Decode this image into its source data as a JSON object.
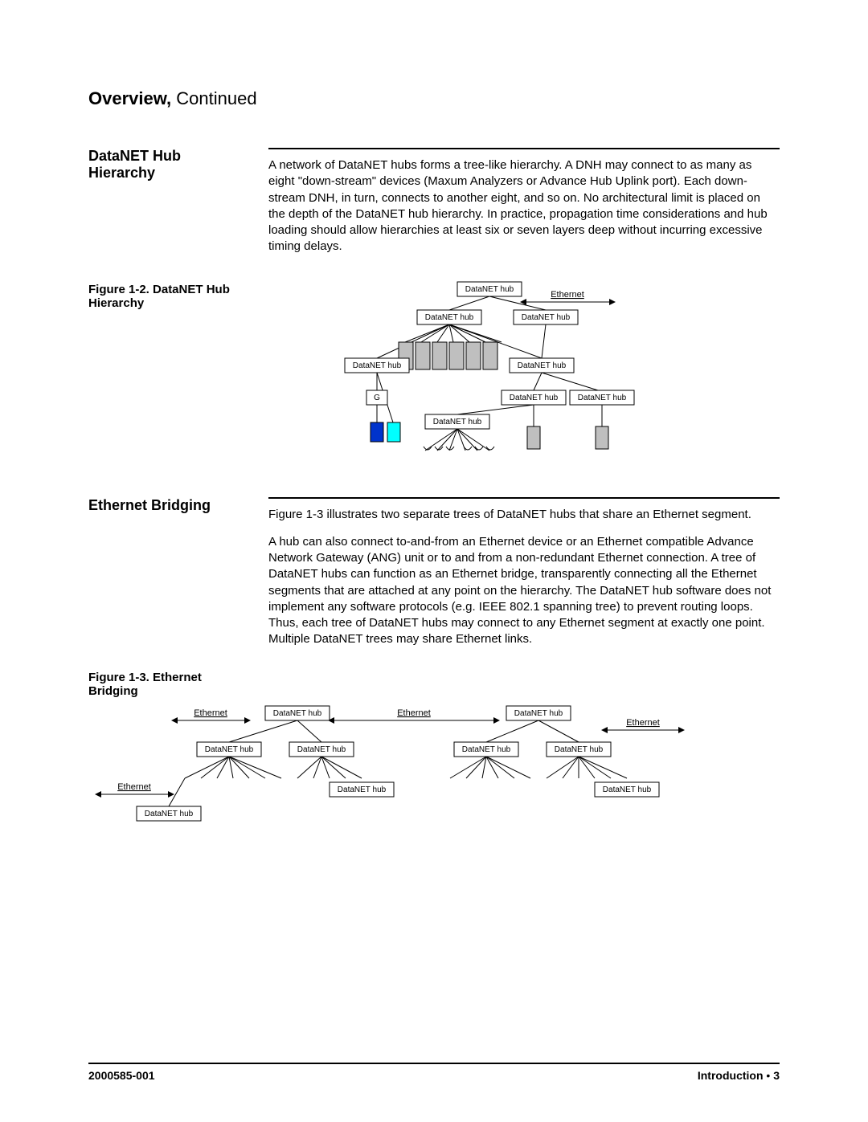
{
  "title": {
    "main": "Overview,",
    "cont": " Continued"
  },
  "section1": {
    "heading": "DataNET Hub Hierarchy",
    "para": "A network of DataNET hubs forms a tree-like hierarchy. A DNH may connect to as many as eight \"down-stream\" devices (Maxum Analyzers or Advance Hub Uplink port). Each down-stream DNH, in turn, connects to another eight, and so on. No architectural limit is placed on the depth of the DataNET hub hierarchy. In practice, propagation time considerations and hub loading should allow hierarchies at least six or seven layers deep without incurring excessive timing delays.",
    "fig_caption": "Figure 1-2. DataNET Hub Hierarchy"
  },
  "labels": {
    "hub": "DataNET hub",
    "ethernet": "Ethernet",
    "g": "G"
  },
  "section2": {
    "heading": "Ethernet Bridging",
    "para1": "Figure 1-3 illustrates two separate trees of DataNET hubs that share an Ethernet segment.",
    "para2": "A hub can also connect to-and-from an Ethernet device or an Ethernet compatible Advance Network Gateway (ANG) unit or to and from a non-redundant Ethernet connection. A tree of DataNET hubs can function as an Ethernet bridge, transparently connecting all the Ethernet segments that are attached at any point on the hierarchy. The DataNET hub software does not implement any software protocols (e.g. IEEE 802.1 spanning tree) to prevent routing loops. Thus, each tree of DataNET hubs may connect to any Ethernet segment at exactly one point. Multiple DataNET trees may share Ethernet links.",
    "fig_caption": "Figure 1-3. Ethernet Bridging"
  },
  "footer": {
    "docnum": "2000585-001",
    "section": "Introduction",
    "bullet": " • ",
    "page": "3"
  }
}
